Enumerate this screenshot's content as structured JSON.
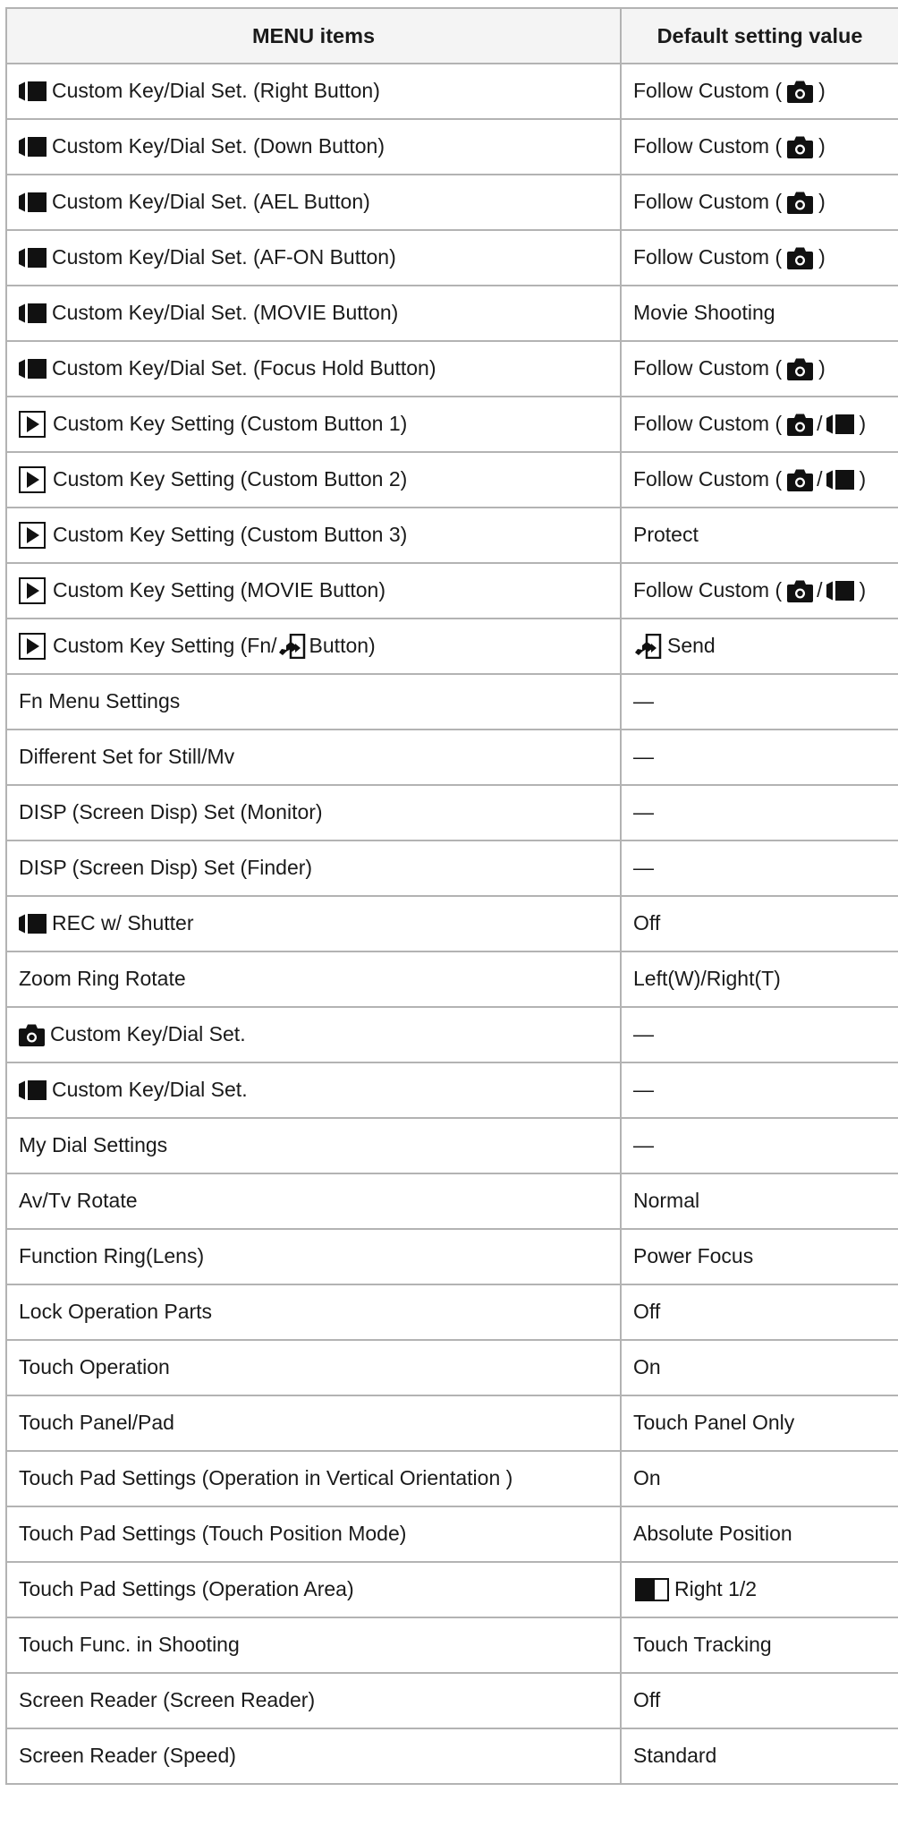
{
  "table": {
    "headers": [
      "MENU items",
      "Default setting value"
    ],
    "rows": [
      {
        "icon": "movie-icon",
        "item": "Custom Key/Dial Set. (Right Button)",
        "value": "Follow Custom (",
        "value_icons": [
          "camera-icon"
        ],
        "value_suffix": ")"
      },
      {
        "icon": "movie-icon",
        "item": "Custom Key/Dial Set. (Down Button)",
        "value": "Follow Custom (",
        "value_icons": [
          "camera-icon"
        ],
        "value_suffix": ")"
      },
      {
        "icon": "movie-icon",
        "item": "Custom Key/Dial Set. (AEL Button)",
        "value": "Follow Custom (",
        "value_icons": [
          "camera-icon"
        ],
        "value_suffix": ")"
      },
      {
        "icon": "movie-icon",
        "item": "Custom Key/Dial Set. (AF-ON Button)",
        "value": "Follow Custom (",
        "value_icons": [
          "camera-icon"
        ],
        "value_suffix": ")"
      },
      {
        "icon": "movie-icon",
        "item": "Custom Key/Dial Set. (MOVIE Button)",
        "value": "Movie Shooting"
      },
      {
        "icon": "movie-icon",
        "item": "Custom Key/Dial Set. (Focus Hold Button)",
        "value": "Follow Custom (",
        "value_icons": [
          "camera-icon"
        ],
        "value_suffix": ")"
      },
      {
        "icon": "play-icon",
        "item": "Custom Key Setting (Custom Button 1)",
        "value": "Follow Custom (",
        "value_icons": [
          "camera-icon",
          "movie-icon"
        ],
        "value_suffix": ")"
      },
      {
        "icon": "play-icon",
        "item": "Custom Key Setting (Custom Button 2)",
        "value": "Follow Custom (",
        "value_icons": [
          "camera-icon",
          "movie-icon"
        ],
        "value_suffix": ")"
      },
      {
        "icon": "play-icon",
        "item": "Custom Key Setting (Custom Button 3)",
        "value": "Protect"
      },
      {
        "icon": "play-icon",
        "item": "Custom Key Setting (MOVIE Button)",
        "value": "Follow Custom (",
        "value_icons": [
          "camera-icon",
          "movie-icon"
        ],
        "value_suffix": ")"
      },
      {
        "icon": "play-icon",
        "item": "Custom Key Setting (Fn/",
        "item_icon": "send-icon",
        "item_suffix": "Button)",
        "value_prefix_icon": "send-icon",
        "value": "Send"
      },
      {
        "item": "Fn Menu Settings",
        "value": "—"
      },
      {
        "item": "Different Set for Still/Mv",
        "value": "—"
      },
      {
        "item": "DISP (Screen Disp) Set (Monitor)",
        "value": "—"
      },
      {
        "item": "DISP (Screen Disp) Set (Finder)",
        "value": "—"
      },
      {
        "icon": "movie-icon",
        "item": "REC w/ Shutter",
        "value": "Off"
      },
      {
        "item": "Zoom Ring Rotate",
        "value": "Left(W)/Right(T)"
      },
      {
        "icon": "camera-icon",
        "item": "Custom Key/Dial Set.",
        "value": "—"
      },
      {
        "icon": "movie-icon",
        "item": "Custom Key/Dial Set.",
        "value": "—"
      },
      {
        "item": "My Dial Settings",
        "value": "—"
      },
      {
        "item": "Av/Tv Rotate",
        "value": "Normal"
      },
      {
        "item": "Function Ring(Lens)",
        "value": "Power Focus"
      },
      {
        "item": "Lock Operation Parts",
        "value": "Off"
      },
      {
        "item": "Touch Operation",
        "value": "On"
      },
      {
        "item": "Touch Panel/Pad",
        "value": "Touch Panel Only"
      },
      {
        "item": "Touch Pad Settings (Operation in Vertical Orientation )",
        "value": "On"
      },
      {
        "item": "Touch Pad Settings (Touch Position Mode)",
        "value": "Absolute Position"
      },
      {
        "item": "Touch Pad Settings (Operation Area)",
        "value_prefix_icon": "right-half-area-icon",
        "value": "Right 1/2"
      },
      {
        "item": "Touch Func. in Shooting",
        "value": "Touch Tracking"
      },
      {
        "item": "Screen Reader (Screen Reader)",
        "value": "Off"
      },
      {
        "item": "Screen Reader (Speed)",
        "value": "Standard"
      }
    ]
  }
}
